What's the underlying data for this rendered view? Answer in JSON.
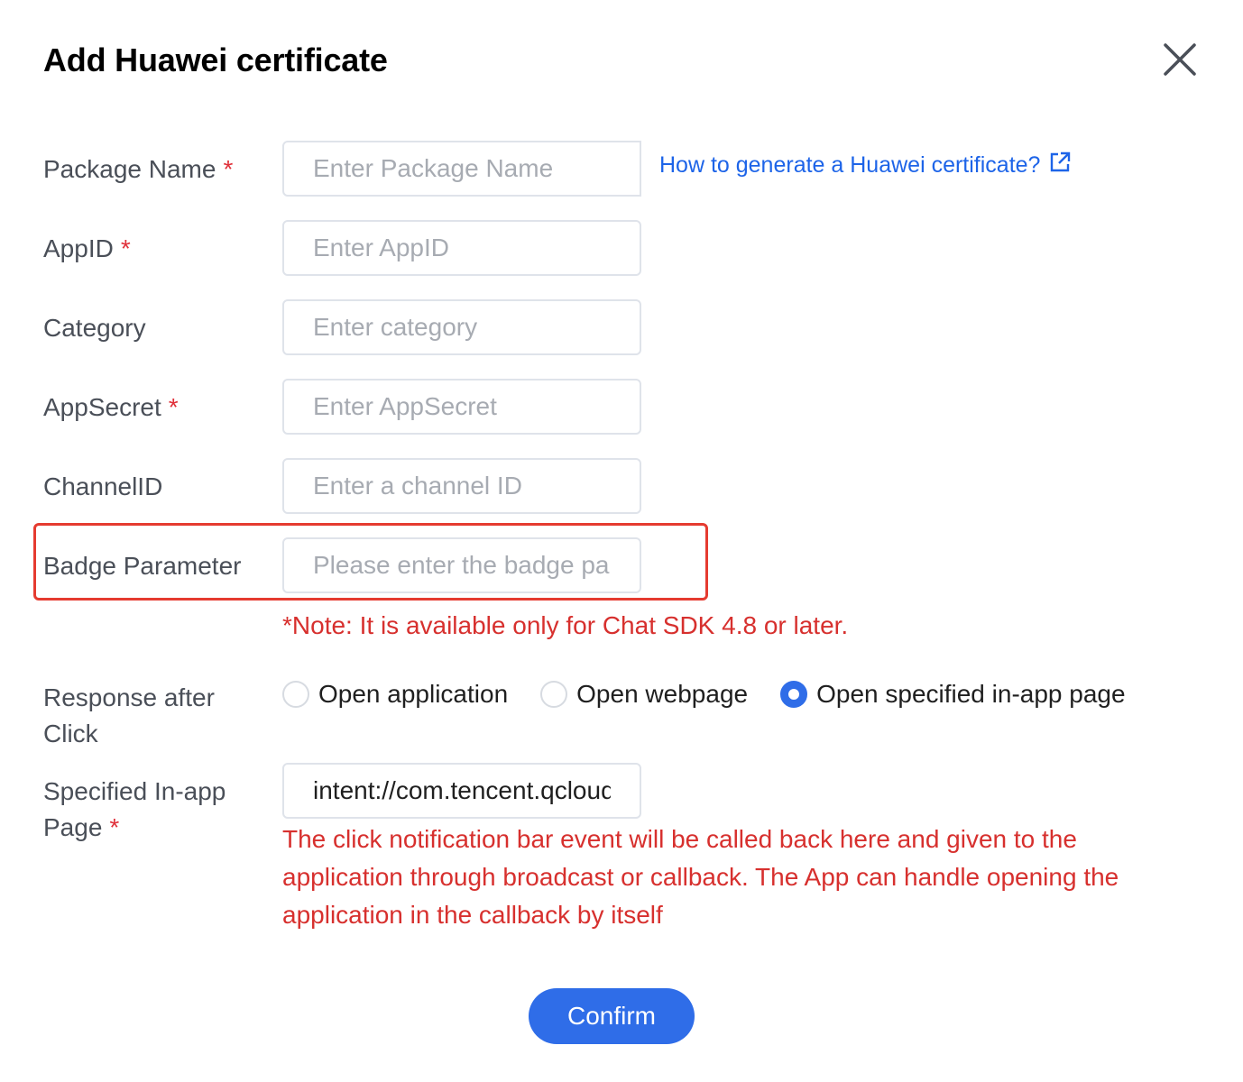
{
  "dialog": {
    "title": "Add Huawei certificate",
    "close_icon": "close-icon",
    "help_link": "How to generate a Huawei certificate?",
    "help_link_icon": "external-link-icon"
  },
  "fields": {
    "package_name": {
      "label": "Package Name",
      "required": "*",
      "placeholder": "Enter Package Name"
    },
    "app_id": {
      "label": "AppID",
      "required": "*",
      "placeholder": "Enter AppID"
    },
    "category": {
      "label": "Category",
      "placeholder": "Enter category"
    },
    "app_secret": {
      "label": "AppSecret",
      "required": "*",
      "placeholder": "Enter AppSecret"
    },
    "channel_id": {
      "label": "ChannelID",
      "placeholder": "Enter a channel ID"
    },
    "badge_parameter": {
      "label": "Badge Parameter",
      "placeholder": "Please enter the badge parameter"
    },
    "badge_note": "*Note: It is available only for Chat SDK 4.8 or later.",
    "response_after_click": {
      "label_line1": "Response after",
      "label_line2": "Click",
      "options": [
        "Open application",
        "Open webpage",
        "Open specified in-app page"
      ],
      "selected": "Open specified in-app page"
    },
    "in_app_page": {
      "label_line1": "Specified In-app",
      "label_line2": "Page",
      "required": "*",
      "value": "intent://com.tencent.qcloud",
      "hint": "The click notification bar event will be called back here and given to the application through broadcast or callback. The App can handle opening the application in the callback by itself"
    }
  },
  "actions": {
    "confirm": "Confirm"
  },
  "colors": {
    "accent": "#2f6de8",
    "link": "#1d64e8",
    "error": "#d7302e",
    "highlight_border": "#e53b30"
  }
}
